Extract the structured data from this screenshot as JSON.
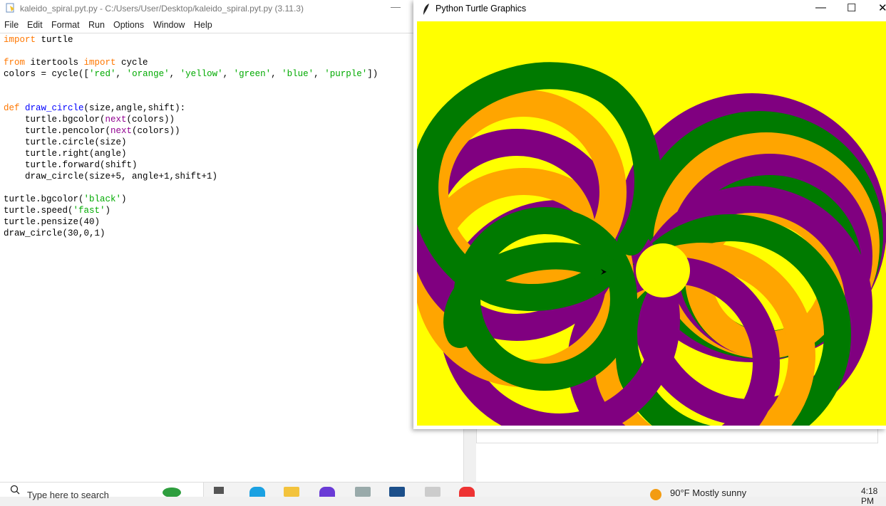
{
  "idle": {
    "title": "kaleido_spiral.pyt.py - C:/Users/User/Desktop/kaleido_spiral.pyt.py (3.11.3)",
    "minimize_glyph": "—",
    "menu": [
      "File",
      "Edit",
      "Format",
      "Run",
      "Options",
      "Window",
      "Help"
    ],
    "code": {
      "l1a": "import",
      "l1b": " turtle",
      "l3a": "from",
      "l3b": " itertools ",
      "l3c": "import",
      "l3d": " cycle",
      "l4a": "colors = cycle([",
      "l4s1": "'red'",
      "l4c1": ", ",
      "l4s2": "'orange'",
      "l4c2": ", ",
      "l4s3": "'yellow'",
      "l4c3": ", ",
      "l4s4": "'green'",
      "l4c4": ", ",
      "l4s5": "'blue'",
      "l4c5": ", ",
      "l4s6": "'purple'",
      "l4e": "])",
      "l7a": "def",
      "l7b": " ",
      "l7c": "draw_circle",
      "l7d": "(size,angle,shift):",
      "l8a": "    turtle.bgcolor(",
      "l8b": "next",
      "l8c": "(colors))",
      "l9a": "    turtle.pencolor(",
      "l9b": "next",
      "l9c": "(colors))",
      "l10": "    turtle.circle(size)",
      "l11": "    turtle.right(angle)",
      "l12": "    turtle.forward(shift)",
      "l13": "    draw_circle(size+5, angle+1,shift+1)",
      "l15a": "turtle.bgcolor(",
      "l15b": "'black'",
      "l15c": ")",
      "l16a": "turtle.speed(",
      "l16b": "'fast'",
      "l16c": ")",
      "l17": "turtle.pensize(40)",
      "l18": "draw_circle(30,0,1)"
    }
  },
  "turtle_window": {
    "title": "Python Turtle Graphics",
    "minimize": "—",
    "maximize": "☐",
    "close": "✕"
  },
  "taskbar": {
    "search_placeholder": "Type here to search",
    "weather": "90°F  Mostly sunny",
    "clock": "4:18 PM"
  },
  "colors": {
    "canvas_bg": "#ffff00",
    "green": "#007a00",
    "purple": "#800080",
    "orange": "#ffa500",
    "keyword": "#ff7700",
    "string": "#00aa00",
    "builtin": "#900090",
    "defname": "#0000ff"
  },
  "icons": [
    "idle-app-icon",
    "feather-icon",
    "search-icon",
    "weather-icon",
    "edge-icon",
    "file-explorer-icon",
    "chrome-icon"
  ]
}
